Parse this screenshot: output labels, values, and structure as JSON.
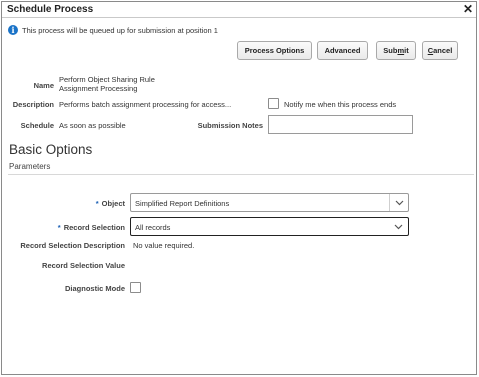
{
  "dialog": {
    "title": "Schedule Process",
    "close_glyph": "✕",
    "info_icon": "info-icon",
    "info_text": "This process will be queued up for submission at position 1"
  },
  "buttons": {
    "process_options": "Process Options",
    "advanced": "Advanced",
    "submit_pre": "Sub",
    "submit_access": "m",
    "submit_post": "it",
    "cancel_access": "C",
    "cancel_post": "ancel"
  },
  "details": {
    "name_label": "Name",
    "name_line1": "Perform Object Sharing Rule",
    "name_line2": "Assignment Processing",
    "description_label": "Description",
    "description_value": "Performs batch assignment processing for access...",
    "notify_label": "Notify me when this process ends",
    "notify_checked": false,
    "schedule_label": "Schedule",
    "schedule_value": "As soon as possible",
    "submission_notes_label": "Submission Notes",
    "submission_notes_value": ""
  },
  "basic_options": {
    "title": "Basic Options",
    "subtitle": "Parameters",
    "required_marker": "*",
    "object_label": "Object",
    "object_value": "Simplified Report Definitions",
    "record_selection_label": "Record Selection",
    "record_selection_value": "All records",
    "record_selection_description_label": "Record Selection Description",
    "record_selection_description_value": "No value required.",
    "record_selection_value_label": "Record Selection Value",
    "diagnostic_mode_label": "Diagnostic Mode",
    "diagnostic_mode_checked": false
  },
  "colors": {
    "accent": "#1a73c8",
    "required": "#1a5fb4"
  }
}
